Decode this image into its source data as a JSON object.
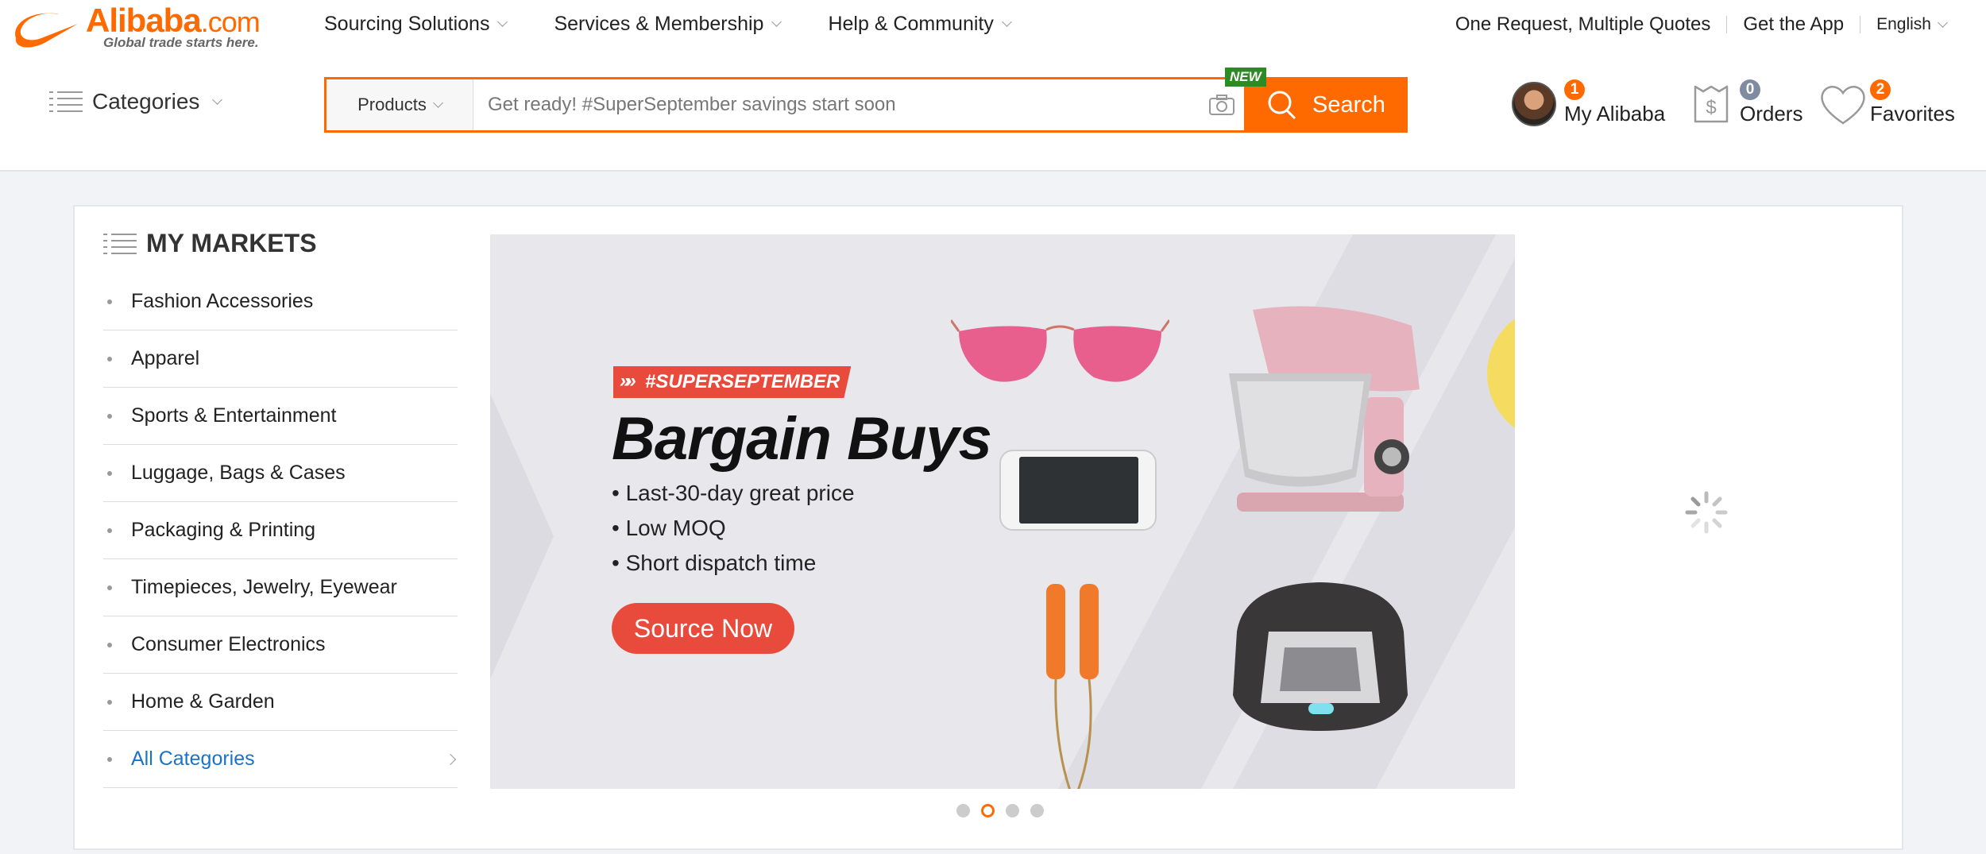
{
  "header": {
    "logo_word": "Alibaba",
    "logo_dotcom": ".com",
    "logo_tagline": "Global trade starts here.",
    "nav": [
      {
        "label": "Sourcing Solutions"
      },
      {
        "label": "Services & Membership"
      },
      {
        "label": "Help & Community"
      }
    ],
    "links": {
      "quotes": "One Request, Multiple Quotes",
      "app": "Get the App",
      "language": "English"
    },
    "categories_label": "Categories",
    "search": {
      "category": "Products",
      "placeholder": "Get ready! #SuperSeptember savings start soon",
      "button": "Search",
      "new_badge": "NEW"
    },
    "account": {
      "my_alibaba": {
        "label": "My Alibaba",
        "count": "1"
      },
      "orders": {
        "label": "Orders",
        "count": "0"
      },
      "favorites": {
        "label": "Favorites",
        "count": "2"
      }
    }
  },
  "markets": {
    "title": "MY MARKETS",
    "items": [
      "Fashion Accessories",
      "Apparel",
      "Sports & Entertainment",
      "Luggage, Bags & Cases",
      "Packaging & Printing",
      "Timepieces, Jewelry, Eyewear",
      "Consumer Electronics",
      "Home & Garden"
    ],
    "all_label": "All Categories"
  },
  "banner": {
    "tag": "#SUPERSEPTEMBER",
    "headline": "Bargain Buys",
    "bullets": [
      "Last-30-day great price",
      "Low MOQ",
      "Short dispatch time"
    ],
    "cta": "Source Now",
    "slide_count": 4,
    "active_slide": 2
  },
  "colors": {
    "brand": "#ff6a00",
    "banner_accent": "#e84b3c",
    "link": "#1a73c8"
  }
}
